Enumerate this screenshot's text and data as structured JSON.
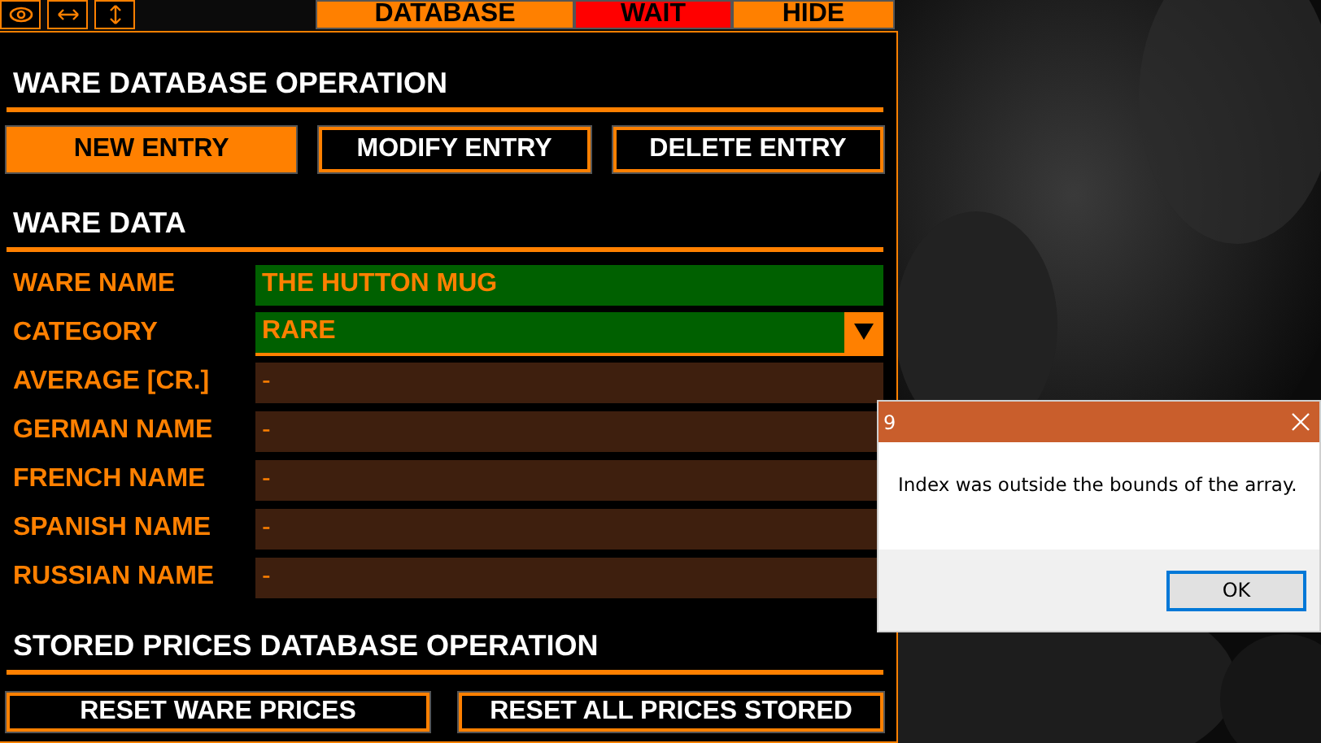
{
  "toolbar": {
    "icon_buttons": [
      {
        "kind": "eye"
      },
      {
        "kind": "horizontal"
      },
      {
        "kind": "vertical"
      }
    ],
    "tabs": [
      {
        "label": "DATABASE",
        "color": "#ff8000"
      },
      {
        "label": "WAIT",
        "color": "#ff0000"
      },
      {
        "label": "HIDE",
        "color": "#ff8000"
      }
    ]
  },
  "ware_database_operation": {
    "title": "WARE DATABASE OPERATION",
    "buttons": [
      {
        "label": "NEW ENTRY",
        "selected": true
      },
      {
        "label": "MODIFY ENTRY",
        "selected": false
      },
      {
        "label": "DELETE ENTRY",
        "selected": false
      }
    ]
  },
  "ware_data": {
    "title": "WARE DATA",
    "fields": [
      {
        "label": "WARE NAME",
        "kind": "text",
        "value": "THE HUTTON MUG",
        "highlighted": true
      },
      {
        "label": "CATEGORY",
        "kind": "dropdown",
        "value": "RARE",
        "highlighted": true
      },
      {
        "label": "AVERAGE [CR.]",
        "kind": "text",
        "value": "-",
        "highlighted": false
      },
      {
        "label": "GERMAN NAME",
        "kind": "text",
        "value": "-",
        "highlighted": false
      },
      {
        "label": "FRENCH NAME",
        "kind": "text",
        "value": "-",
        "highlighted": false
      },
      {
        "label": "SPANISH NAME",
        "kind": "text",
        "value": "-",
        "highlighted": false
      },
      {
        "label": "RUSSIAN NAME",
        "kind": "text",
        "value": "-",
        "highlighted": false
      }
    ]
  },
  "stored_prices_operation": {
    "title": "STORED PRICES DATABASE OPERATION",
    "buttons": [
      {
        "label": "RESET WARE PRICES"
      },
      {
        "label": "RESET ALL PRICES STORED"
      }
    ]
  },
  "dialog": {
    "title": "9",
    "message": "Index was outside the bounds of the array.",
    "button": "OK"
  }
}
